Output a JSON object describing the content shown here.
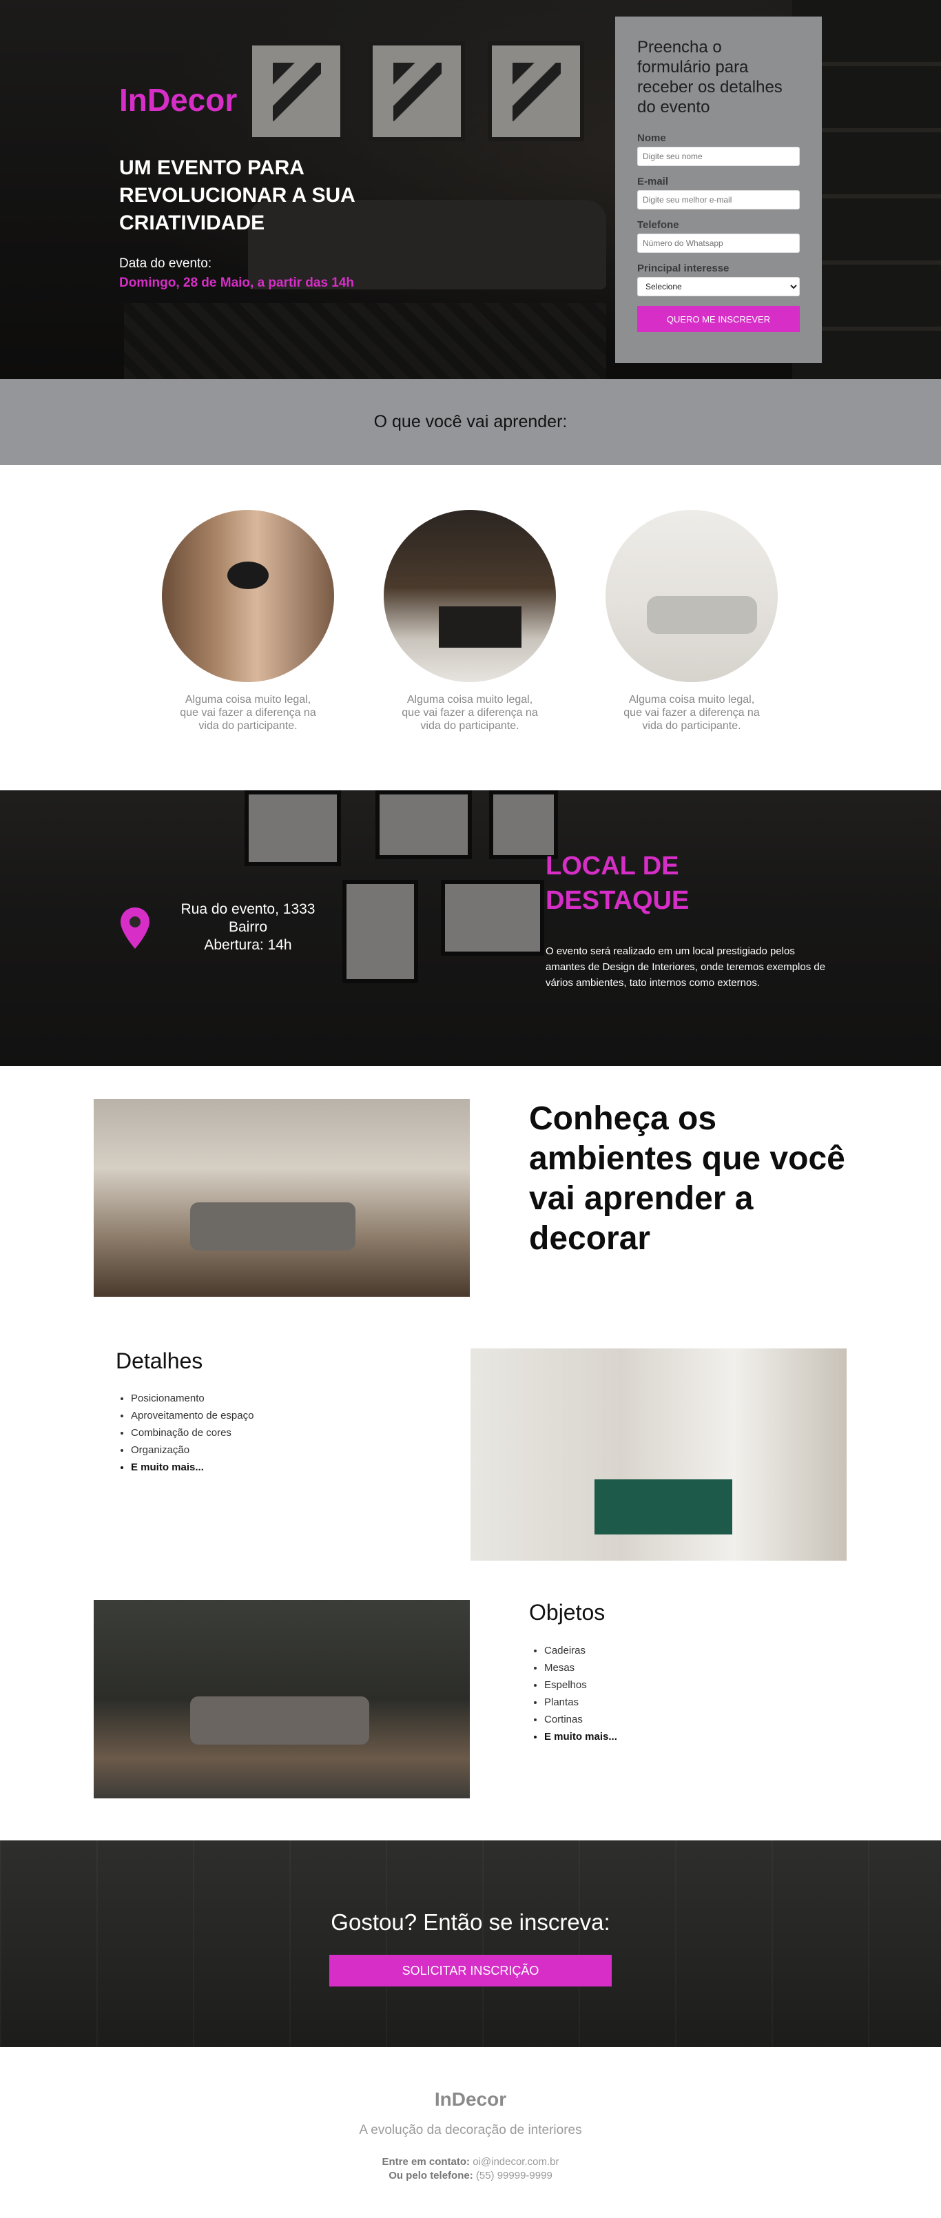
{
  "hero": {
    "brand": "InDecor",
    "headline": "UM EVENTO PARA REVOLUCIONAR A SUA CRIATIVIDADE",
    "date_label": "Data do evento:",
    "date_value": "Domingo, 28 de Maio, a partir das 14h"
  },
  "form": {
    "title": "Preencha o formulário para receber os detalhes do evento",
    "name_label": "Nome",
    "name_placeholder": "Digite seu nome",
    "email_label": "E-mail",
    "email_placeholder": "Digite seu melhor e-mail",
    "phone_label": "Telefone",
    "phone_placeholder": "Número do Whatsapp",
    "interest_label": "Principal interesse",
    "interest_selected": "Selecione",
    "submit_label": "QUERO ME INSCREVER"
  },
  "learn": {
    "heading": "O que você vai aprender:",
    "items": [
      {
        "text": "Alguma coisa muito legal, que vai fazer a diferença na vida do participante."
      },
      {
        "text": "Alguma coisa muito legal, que vai fazer a diferença na vida do participante."
      },
      {
        "text": "Alguma coisa muito legal, que vai fazer a diferença na vida do participante."
      }
    ]
  },
  "location": {
    "address_line1": "Rua do evento, 1333",
    "address_line2": "Bairro",
    "address_line3": "Abertura: 14h",
    "title": "LOCAL DE DESTAQUE",
    "text": "O evento será realizado em um local prestigiado pelos amantes de Design de Interiores, onde teremos exemplos de vários ambientes, tato internos como externos."
  },
  "gallery": {
    "heading": "Conheça os ambientes que você vai aprender a decorar",
    "details": {
      "title": "Detalhes",
      "items": [
        "Posicionamento",
        "Aproveitamento de espaço",
        "Combinação de cores",
        "Organização"
      ],
      "more": "E muito mais..."
    },
    "objects": {
      "title": "Objetos",
      "items": [
        "Cadeiras",
        "Mesas",
        "Espelhos",
        "Plantas",
        "Cortinas"
      ],
      "more": "E muito mais..."
    }
  },
  "cta": {
    "heading": "Gostou? Então se inscreva:",
    "button_label": "SOLICITAR INSCRIÇÃO"
  },
  "footer": {
    "brand": "InDecor",
    "tagline": "A evolução da decoração de interiores",
    "contact_label": "Entre em contato:",
    "contact_value": "oi@indecor.com.br",
    "phone_label": "Ou pelo telefone:",
    "phone_value": "(55) 99999-9999"
  },
  "colors": {
    "accent": "#d62ec7",
    "form_bg": "#8e8f91",
    "learn_bar_bg": "#95969a"
  },
  "icons": {
    "location": "map-pin-icon",
    "select_arrow": "chevron-down-icon"
  }
}
